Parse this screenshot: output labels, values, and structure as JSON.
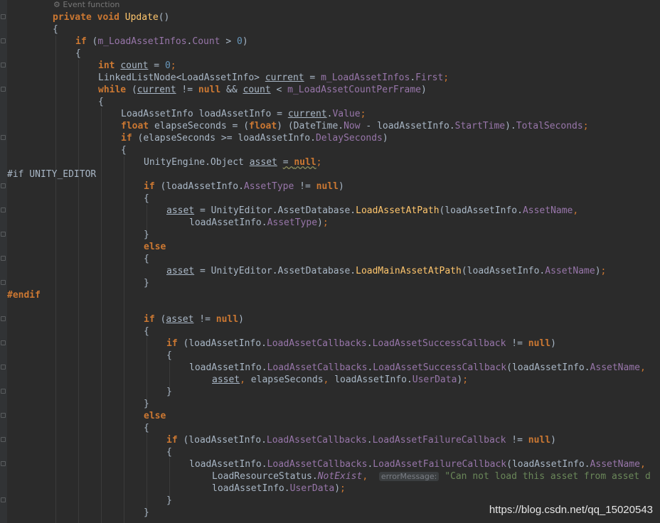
{
  "inlay": {
    "event_function": "Event function"
  },
  "code": {
    "private": "private",
    "void": "void",
    "update_name": "Update",
    "parens": "()",
    "if": "if",
    "else": "else",
    "while": "while",
    "int": "int",
    "float": "float",
    "null": "null",
    "open_brace": "{",
    "close_brace": "}",
    "m_load_asset_infos": "m_LoadAssetInfos",
    "count_prop": "Count",
    "zero": "0",
    "count_var": "count",
    "linked_list_node": "LinkedListNode<LoadAssetInfo>",
    "current": "current",
    "first": "First",
    "m_load_asset_count_per_frame": "m_LoadAssetCountPerFrame",
    "load_asset_info_type": "LoadAssetInfo",
    "load_asset_info": "loadAssetInfo",
    "value": "Value",
    "elapse_seconds": "elapseSeconds",
    "date_time": "DateTime",
    "now": "Now",
    "start_time": "StartTime",
    "total_seconds": "TotalSeconds",
    "delay_seconds": "DelaySeconds",
    "unity_object": "UnityEngine.Object",
    "asset": "asset",
    "pp_if": "#if UNITY_EDITOR",
    "pp_endif": "#endif",
    "asset_type": "AssetType",
    "unity_editor_adb": "UnityEditor.AssetDatabase",
    "load_asset_at_path": "LoadAssetAtPath",
    "asset_name": "AssetName",
    "load_main_asset_at_path": "LoadMainAssetAtPath",
    "load_asset_callbacks": "LoadAssetCallbacks",
    "success_callback": "LoadAssetSuccessCallback",
    "failure_callback": "LoadAssetFailureCallback",
    "user_data": "UserData",
    "load_resource_status": "LoadResourceStatus",
    "not_exist": "NotExist",
    "error_message_hint": "errorMessage:",
    "error_string": "\"Can not load this asset from asset d"
  },
  "watermark": "https://blog.csdn.net/qq_15020543"
}
